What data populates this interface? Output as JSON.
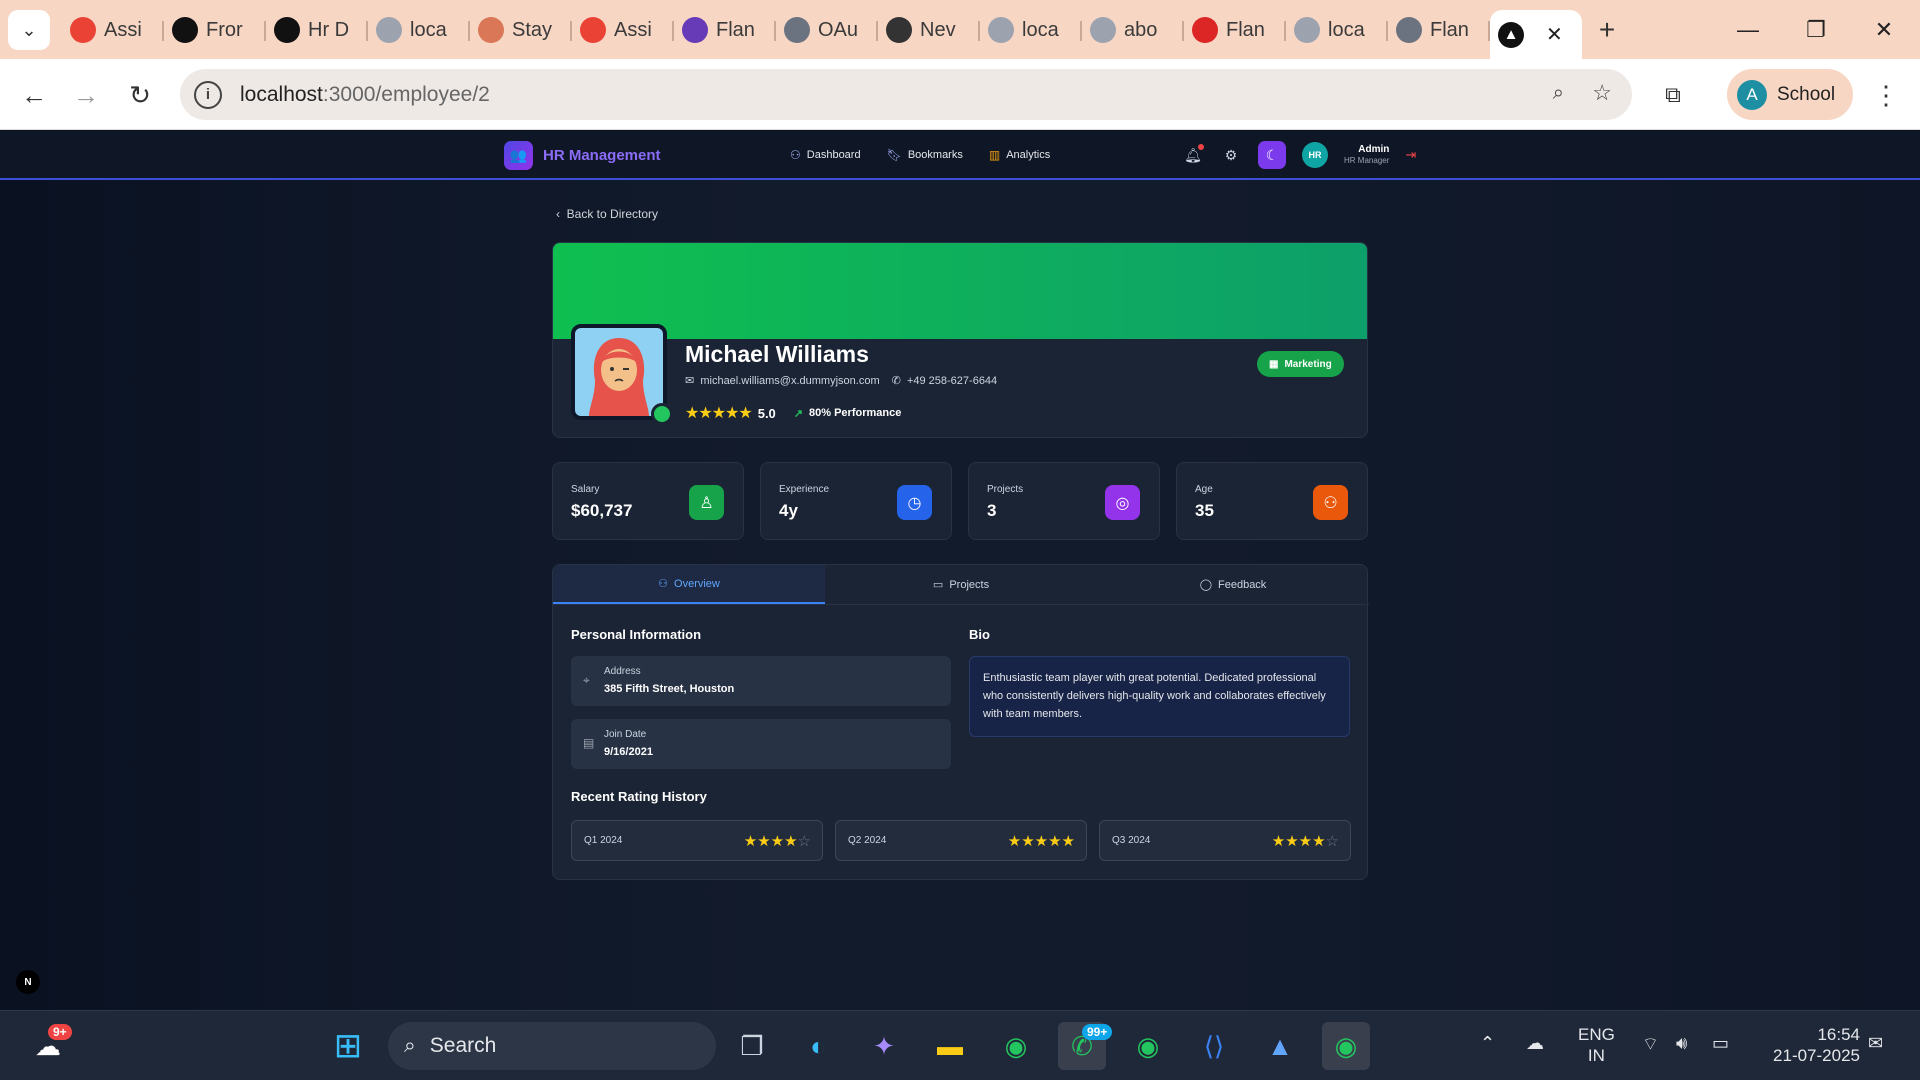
{
  "browser": {
    "tabs": [
      {
        "label": "Assi",
        "icon": "gmail-icon",
        "color": "#ea4335"
      },
      {
        "label": "Fror",
        "icon": "notion-icon",
        "color": "#111111"
      },
      {
        "label": "Hr D",
        "icon": "notion-icon",
        "color": "#111111"
      },
      {
        "label": "loca",
        "icon": "globe-icon",
        "color": "#9ca3af"
      },
      {
        "label": "Stay",
        "icon": "claude-icon",
        "color": "#d97757"
      },
      {
        "label": "Assi",
        "icon": "gmail-icon",
        "color": "#ea4335"
      },
      {
        "label": "Flan",
        "icon": "forms-icon",
        "color": "#673ab7"
      },
      {
        "label": "OAu",
        "icon": "github-icon",
        "color": "#6b7280"
      },
      {
        "label": "Nev",
        "icon": "chrome-icon",
        "color": "#333333"
      },
      {
        "label": "loca",
        "icon": "globe-icon",
        "color": "#9ca3af"
      },
      {
        "label": "abo",
        "icon": "globe-icon",
        "color": "#9ca3af"
      },
      {
        "label": "Flan",
        "icon": "error-icon",
        "color": "#dc2626"
      },
      {
        "label": "loca",
        "icon": "globe-icon",
        "color": "#9ca3af"
      },
      {
        "label": "Flan",
        "icon": "github-icon",
        "color": "#6b7280"
      }
    ],
    "url_host": "localhost",
    "url_path": ":3000/employee/2",
    "profile_initial": "A",
    "profile_name": "School"
  },
  "app": {
    "brand": "HR Management",
    "nav": [
      "Dashboard",
      "Bookmarks",
      "Analytics"
    ],
    "user_initials": "HR",
    "user_name": "Admin",
    "user_role": "HR Manager",
    "back_link": "Back to Directory",
    "accent": "#8b6cf6"
  },
  "employee": {
    "name": "Michael Williams",
    "email": "michael.williams@x.dummyjson.com",
    "phone": "+49 258-627-6644",
    "rating": "5.0",
    "stars": 5,
    "performance": "80% Performance",
    "department": "Marketing"
  },
  "stats": [
    {
      "label": "Salary",
      "value": "$60,737",
      "color": "#16a34a",
      "icon": "award-icon"
    },
    {
      "label": "Experience",
      "value": "4y",
      "color": "#2563eb",
      "icon": "clock-icon"
    },
    {
      "label": "Projects",
      "value": "3",
      "color": "#9333ea",
      "icon": "target-icon"
    },
    {
      "label": "Age",
      "value": "35",
      "color": "#ea580c",
      "icon": "users-icon"
    }
  ],
  "tabs": [
    "Overview",
    "Projects",
    "Feedback"
  ],
  "overview": {
    "personal_title": "Personal Information",
    "address_label": "Address",
    "address": "385 Fifth Street, Houston",
    "join_label": "Join Date",
    "join_date": "9/16/2021",
    "bio_title": "Bio",
    "bio": "Enthusiastic team player with great potential. Dedicated professional who consistently delivers high-quality work and collaborates effectively with team members.",
    "history_title": "Recent Rating History",
    "history": [
      {
        "quarter": "Q1 2024",
        "stars": 4
      },
      {
        "quarter": "Q2 2024",
        "stars": 5
      },
      {
        "quarter": "Q3 2024",
        "stars": 4
      }
    ]
  },
  "taskbar": {
    "search": "Search",
    "weather_badge": "9+",
    "whatsapp_badge": "99+",
    "lang1": "ENG",
    "lang2": "IN",
    "time": "16:54",
    "date": "21-07-2025"
  }
}
